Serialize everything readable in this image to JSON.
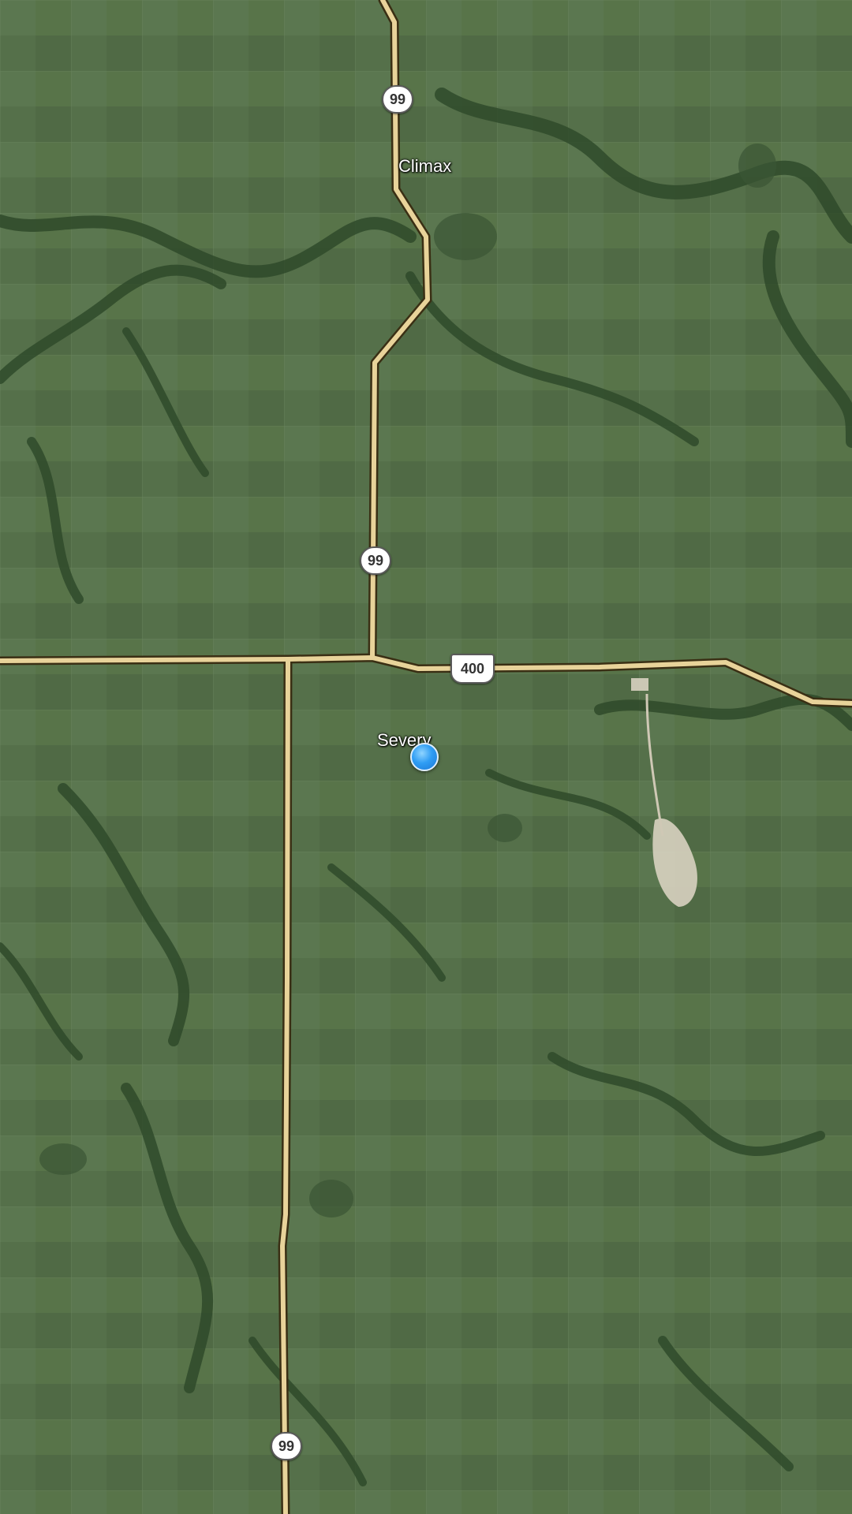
{
  "map": {
    "type": "satellite",
    "places": {
      "climax": "Climax",
      "severy": "Severy"
    },
    "shields": {
      "hwy99_north": "99",
      "hwy99_middle": "99",
      "hwy99_south": "99",
      "us400": "400"
    },
    "colors": {
      "road_fill": "#e8d39a",
      "road_edge": "#3a2f14",
      "location_dot": "#2f9df4"
    },
    "icons": {
      "location": "current-location-dot-icon"
    }
  }
}
